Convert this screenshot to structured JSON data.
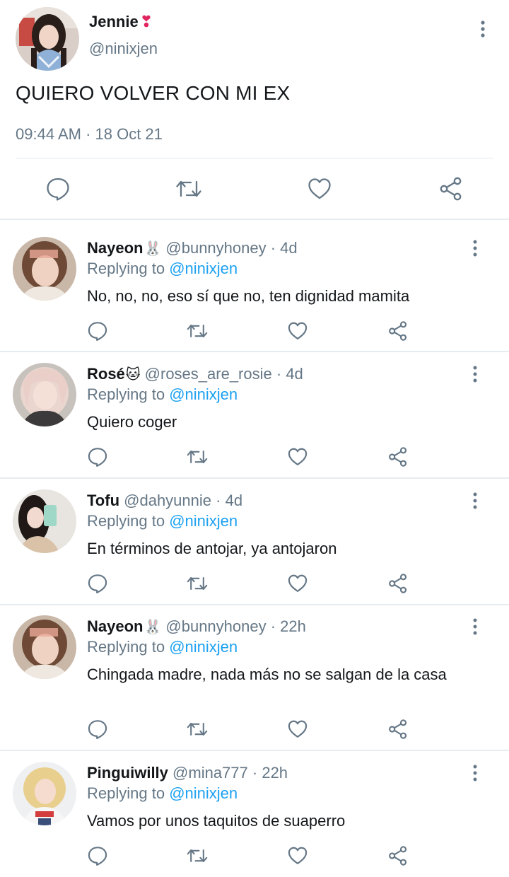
{
  "main_tweet": {
    "name": "Jennie",
    "name_emoji": "❣",
    "handle": "@ninixjen",
    "text": "QUIERO VOLVER CON MI EX",
    "timestamp": "09:44 AM · 18 Oct 21",
    "actions": [
      "reply-icon",
      "retweet-icon",
      "like-icon",
      "share-icon"
    ],
    "more_icon": "more-vertical-icon"
  },
  "colors": {
    "text_primary": "#14171a",
    "text_secondary": "#657786",
    "link": "#1da1f2",
    "divider": "#e6ecf0",
    "icon": "#657786"
  },
  "replies": [
    {
      "name": "Nayeon",
      "emoji": "🐰",
      "handle": "@bunnyhoney",
      "time": "4d",
      "replying_prefix": "Replying to",
      "replying_to": "@ninixjen",
      "text": "No, no, no, eso sí que no, ten dignidad mamita"
    },
    {
      "name": "Rosé",
      "emoji": "🐱",
      "handle": "@roses_are_rosie",
      "time": "4d",
      "replying_prefix": "Replying to",
      "replying_to": "@ninixjen",
      "text": "Quiero coger"
    },
    {
      "name": "Tofu",
      "emoji": "",
      "handle": "@dahyunnie",
      "time": "4d",
      "replying_prefix": "Replying to",
      "replying_to": "@ninixjen",
      "text": "En términos de antojar, ya antojaron"
    },
    {
      "name": "Nayeon",
      "emoji": "🐰",
      "handle": "@bunnyhoney",
      "time": "22h",
      "replying_prefix": "Replying to",
      "replying_to": "@ninixjen",
      "text": "Chingada madre, nada más no se salgan de la casa"
    },
    {
      "name": "Pinguiwilly",
      "emoji": "",
      "handle": "@mina777",
      "time": "22h",
      "replying_prefix": "Replying to",
      "replying_to": "@ninixjen",
      "text": "Vamos por unos taquitos de suaperro"
    }
  ]
}
